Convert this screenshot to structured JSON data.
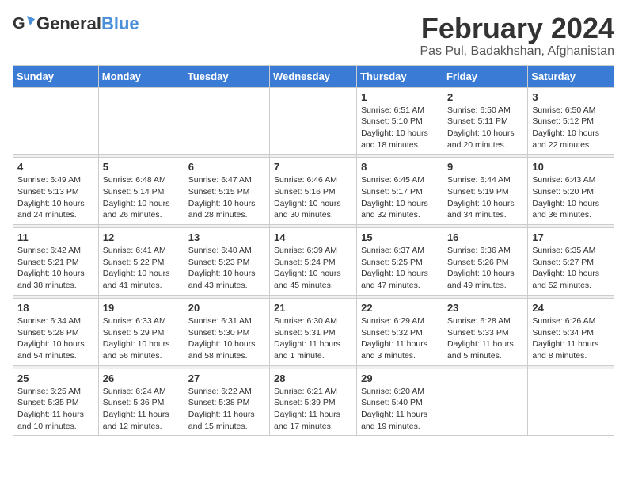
{
  "logo": {
    "general": "General",
    "blue": "Blue"
  },
  "title": {
    "month": "February 2024",
    "location": "Pas Pul, Badakhshan, Afghanistan"
  },
  "headers": [
    "Sunday",
    "Monday",
    "Tuesday",
    "Wednesday",
    "Thursday",
    "Friday",
    "Saturday"
  ],
  "weeks": [
    [
      {
        "day": "",
        "info": ""
      },
      {
        "day": "",
        "info": ""
      },
      {
        "day": "",
        "info": ""
      },
      {
        "day": "",
        "info": ""
      },
      {
        "day": "1",
        "info": "Sunrise: 6:51 AM\nSunset: 5:10 PM\nDaylight: 10 hours\nand 18 minutes."
      },
      {
        "day": "2",
        "info": "Sunrise: 6:50 AM\nSunset: 5:11 PM\nDaylight: 10 hours\nand 20 minutes."
      },
      {
        "day": "3",
        "info": "Sunrise: 6:50 AM\nSunset: 5:12 PM\nDaylight: 10 hours\nand 22 minutes."
      }
    ],
    [
      {
        "day": "4",
        "info": "Sunrise: 6:49 AM\nSunset: 5:13 PM\nDaylight: 10 hours\nand 24 minutes."
      },
      {
        "day": "5",
        "info": "Sunrise: 6:48 AM\nSunset: 5:14 PM\nDaylight: 10 hours\nand 26 minutes."
      },
      {
        "day": "6",
        "info": "Sunrise: 6:47 AM\nSunset: 5:15 PM\nDaylight: 10 hours\nand 28 minutes."
      },
      {
        "day": "7",
        "info": "Sunrise: 6:46 AM\nSunset: 5:16 PM\nDaylight: 10 hours\nand 30 minutes."
      },
      {
        "day": "8",
        "info": "Sunrise: 6:45 AM\nSunset: 5:17 PM\nDaylight: 10 hours\nand 32 minutes."
      },
      {
        "day": "9",
        "info": "Sunrise: 6:44 AM\nSunset: 5:19 PM\nDaylight: 10 hours\nand 34 minutes."
      },
      {
        "day": "10",
        "info": "Sunrise: 6:43 AM\nSunset: 5:20 PM\nDaylight: 10 hours\nand 36 minutes."
      }
    ],
    [
      {
        "day": "11",
        "info": "Sunrise: 6:42 AM\nSunset: 5:21 PM\nDaylight: 10 hours\nand 38 minutes."
      },
      {
        "day": "12",
        "info": "Sunrise: 6:41 AM\nSunset: 5:22 PM\nDaylight: 10 hours\nand 41 minutes."
      },
      {
        "day": "13",
        "info": "Sunrise: 6:40 AM\nSunset: 5:23 PM\nDaylight: 10 hours\nand 43 minutes."
      },
      {
        "day": "14",
        "info": "Sunrise: 6:39 AM\nSunset: 5:24 PM\nDaylight: 10 hours\nand 45 minutes."
      },
      {
        "day": "15",
        "info": "Sunrise: 6:37 AM\nSunset: 5:25 PM\nDaylight: 10 hours\nand 47 minutes."
      },
      {
        "day": "16",
        "info": "Sunrise: 6:36 AM\nSunset: 5:26 PM\nDaylight: 10 hours\nand 49 minutes."
      },
      {
        "day": "17",
        "info": "Sunrise: 6:35 AM\nSunset: 5:27 PM\nDaylight: 10 hours\nand 52 minutes."
      }
    ],
    [
      {
        "day": "18",
        "info": "Sunrise: 6:34 AM\nSunset: 5:28 PM\nDaylight: 10 hours\nand 54 minutes."
      },
      {
        "day": "19",
        "info": "Sunrise: 6:33 AM\nSunset: 5:29 PM\nDaylight: 10 hours\nand 56 minutes."
      },
      {
        "day": "20",
        "info": "Sunrise: 6:31 AM\nSunset: 5:30 PM\nDaylight: 10 hours\nand 58 minutes."
      },
      {
        "day": "21",
        "info": "Sunrise: 6:30 AM\nSunset: 5:31 PM\nDaylight: 11 hours\nand 1 minute."
      },
      {
        "day": "22",
        "info": "Sunrise: 6:29 AM\nSunset: 5:32 PM\nDaylight: 11 hours\nand 3 minutes."
      },
      {
        "day": "23",
        "info": "Sunrise: 6:28 AM\nSunset: 5:33 PM\nDaylight: 11 hours\nand 5 minutes."
      },
      {
        "day": "24",
        "info": "Sunrise: 6:26 AM\nSunset: 5:34 PM\nDaylight: 11 hours\nand 8 minutes."
      }
    ],
    [
      {
        "day": "25",
        "info": "Sunrise: 6:25 AM\nSunset: 5:35 PM\nDaylight: 11 hours\nand 10 minutes."
      },
      {
        "day": "26",
        "info": "Sunrise: 6:24 AM\nSunset: 5:36 PM\nDaylight: 11 hours\nand 12 minutes."
      },
      {
        "day": "27",
        "info": "Sunrise: 6:22 AM\nSunset: 5:38 PM\nDaylight: 11 hours\nand 15 minutes."
      },
      {
        "day": "28",
        "info": "Sunrise: 6:21 AM\nSunset: 5:39 PM\nDaylight: 11 hours\nand 17 minutes."
      },
      {
        "day": "29",
        "info": "Sunrise: 6:20 AM\nSunset: 5:40 PM\nDaylight: 11 hours\nand 19 minutes."
      },
      {
        "day": "",
        "info": ""
      },
      {
        "day": "",
        "info": ""
      }
    ]
  ]
}
